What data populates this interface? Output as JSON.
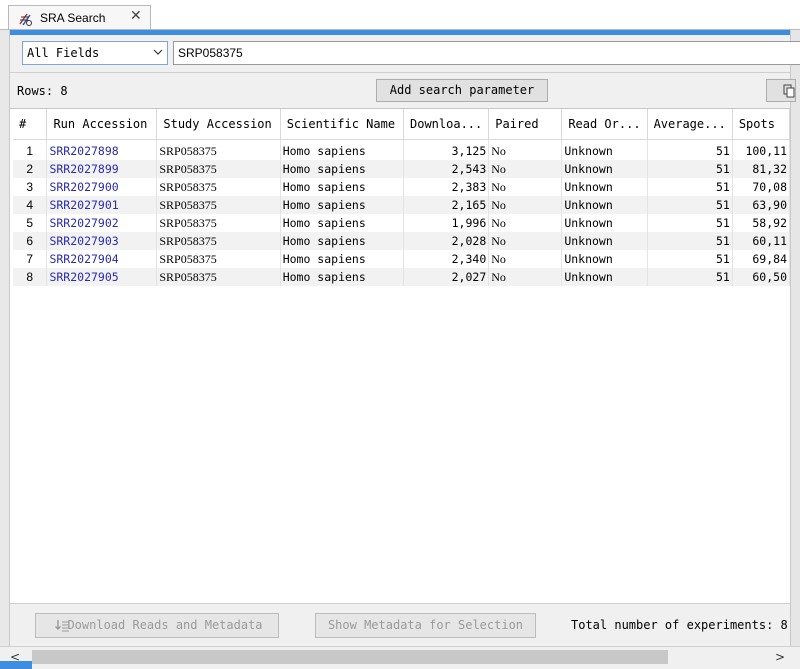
{
  "tab": {
    "title": "SRA Search",
    "close": "✕"
  },
  "search": {
    "field_selected": "All Fields",
    "query": "SRP058375"
  },
  "toolbar": {
    "rows_label": "Rows: 8",
    "add_param_label": "Add search parameter"
  },
  "table": {
    "headers": [
      "#",
      "Run Accession",
      "Study Accession",
      "Scientific Name",
      "Downloa...",
      "Paired",
      "Read Or...",
      "Average...",
      "Spots"
    ],
    "rows": [
      [
        "1",
        "SRR2027898",
        "SRP058375",
        "Homo sapiens",
        "3,125",
        "No",
        "Unknown",
        "51",
        "100,11"
      ],
      [
        "2",
        "SRR2027899",
        "SRP058375",
        "Homo sapiens",
        "2,543",
        "No",
        "Unknown",
        "51",
        "81,32"
      ],
      [
        "3",
        "SRR2027900",
        "SRP058375",
        "Homo sapiens",
        "2,383",
        "No",
        "Unknown",
        "51",
        "70,08"
      ],
      [
        "4",
        "SRR2027901",
        "SRP058375",
        "Homo sapiens",
        "2,165",
        "No",
        "Unknown",
        "51",
        "63,90"
      ],
      [
        "5",
        "SRR2027902",
        "SRP058375",
        "Homo sapiens",
        "1,996",
        "No",
        "Unknown",
        "51",
        "58,92"
      ],
      [
        "6",
        "SRR2027903",
        "SRP058375",
        "Homo sapiens",
        "2,028",
        "No",
        "Unknown",
        "51",
        "60,11"
      ],
      [
        "7",
        "SRR2027904",
        "SRP058375",
        "Homo sapiens",
        "2,340",
        "No",
        "Unknown",
        "51",
        "69,84"
      ],
      [
        "8",
        "SRR2027905",
        "SRP058375",
        "Homo sapiens",
        "2,027",
        "No",
        "Unknown",
        "51",
        "60,50"
      ]
    ]
  },
  "footer": {
    "download_label": "Download Reads and Metadata",
    "show_meta_label": "Show Metadata for Selection",
    "total_label": "Total number of experiments: 8"
  },
  "icons": {
    "tab": "sra-search-icon",
    "select": "chevron-down-icon",
    "download": "download-icon",
    "copy": "copy-icon"
  },
  "colors": {
    "accent": "#3d8ee0",
    "link": "#2a2ab0",
    "alt_row": "#f2f2f2"
  }
}
